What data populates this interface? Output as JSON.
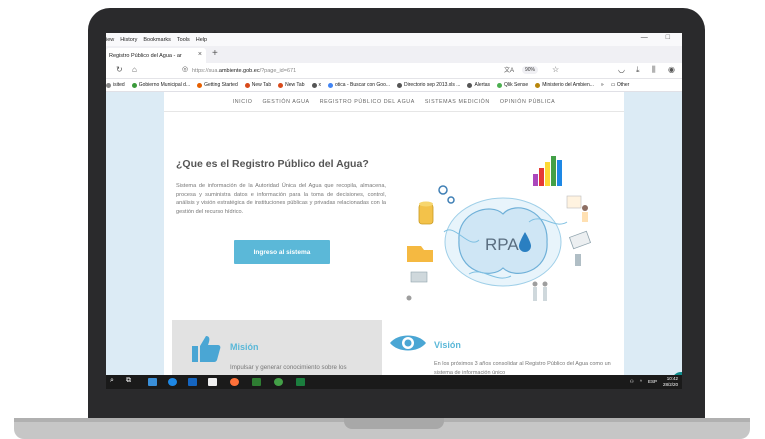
{
  "browser": {
    "menu": [
      "iew",
      "History",
      "Bookmarks",
      "Tools",
      "Help"
    ],
    "tab_title": "Registro Público del Agua - ar",
    "url_prefix": "https://sua.",
    "url_domain": "ambiente.gob.ec",
    "url_suffix": "/?page_id=671",
    "zoom": "90%",
    "bookmarks": [
      {
        "label": "isited",
        "color": "#888888"
      },
      {
        "label": "Gobierno Municipal d...",
        "color": "#3a9a3a"
      },
      {
        "label": "Getting Started",
        "color": "#e66000"
      },
      {
        "label": "New Tab",
        "color": "#d84a1b"
      },
      {
        "label": "New Tab",
        "color": "#d84a1b"
      },
      {
        "label": "x",
        "color": "#555555"
      },
      {
        "label": "otica - Buscar con Goo...",
        "color": "#4285f4"
      },
      {
        "label": "Directorio sep 2013.xls ...",
        "color": "#555555"
      },
      {
        "label": "Alertas",
        "color": "#555555"
      },
      {
        "label": "Qlik Sense",
        "color": "#4caf50"
      },
      {
        "label": "Ministerio del Ambien...",
        "color": "#b8860b"
      }
    ],
    "other_bookmarks": "Other"
  },
  "site": {
    "nav": [
      "INICIO",
      "GESTIÓN AGUA",
      "REGISTRO PÚBLICO DEL AGUA",
      "SISTEMAS MEDICIÓN",
      "OPINIÓN PÚBLICA"
    ],
    "hero_title": "¿Que es el Registro Público del Agua?",
    "hero_text": "Sistema de información de la Autoridad Única del Agua que recopila, almacena, procesa y suministra datos e información para la toma de decisiones, control, análisis y visión estratégica de instituciones públicas y privadas relacionadas con la gestión del recurso hídrico.",
    "cta_label": "Ingreso al sistema",
    "logo_text": "RPA",
    "mission_title": "Misión",
    "mission_text": "Impulsar y generar conocimiento sobre los",
    "vision_title": "Visión",
    "vision_text": "En los próximos 3 años consolidar al Registro Público del Agua como un sistema de información único"
  },
  "taskbar": {
    "lang": "ESP",
    "time": "10:42",
    "date": "28/2/20"
  },
  "colors": {
    "accent": "#5bb8d8",
    "frame": "#2a2a2c",
    "page_bg": "#dcebf5"
  }
}
